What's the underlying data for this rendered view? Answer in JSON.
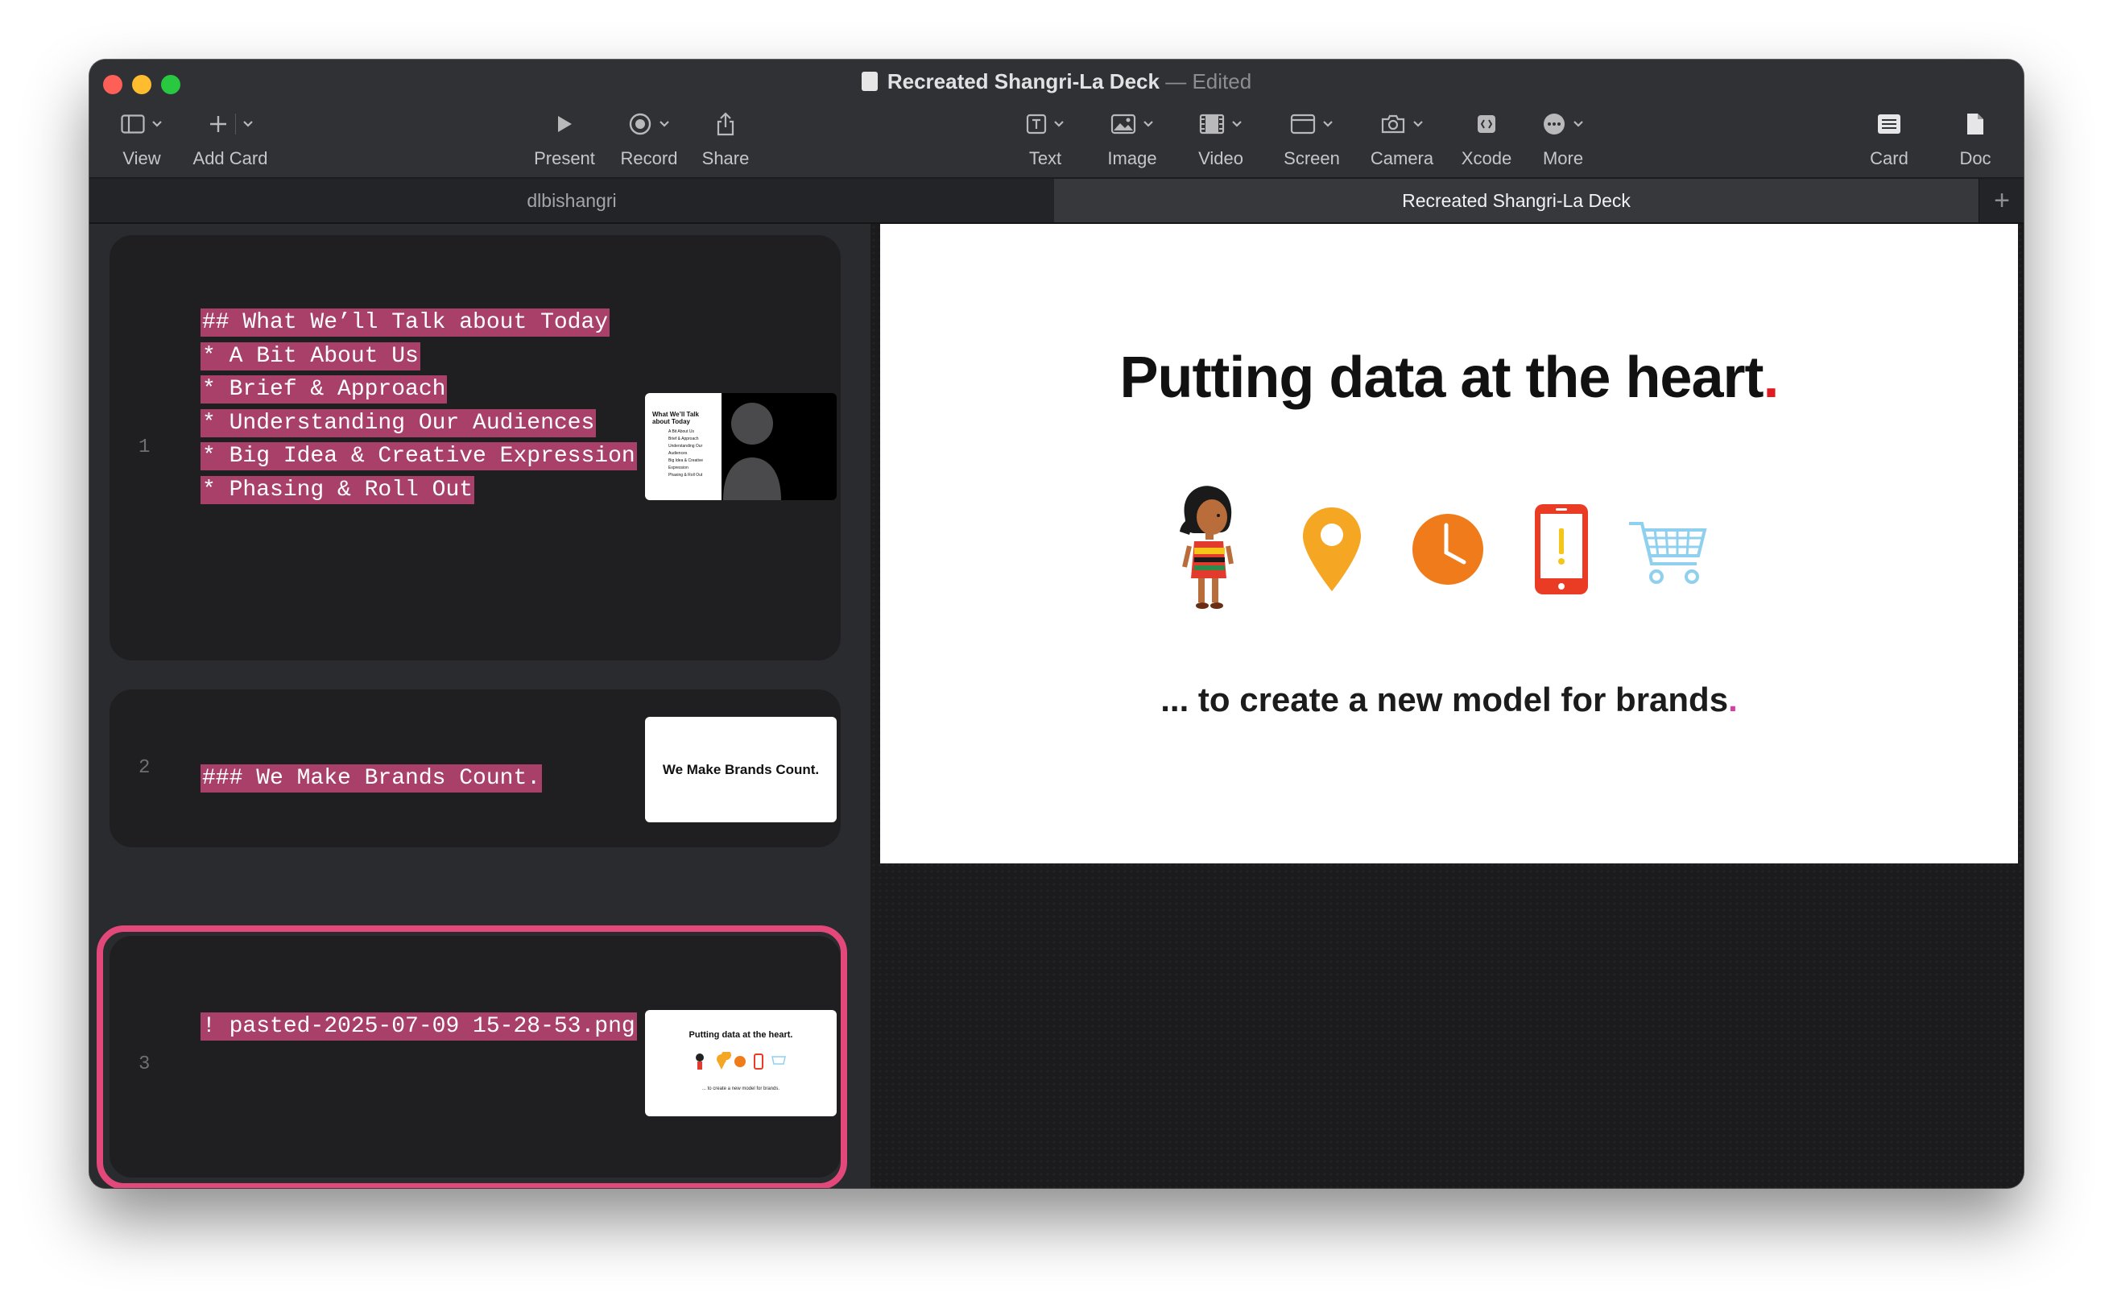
{
  "window": {
    "title": "Recreated Shangri-La Deck",
    "separator": "—",
    "status": "Edited"
  },
  "toolbar": {
    "view": "View",
    "add_card": "Add Card",
    "present": "Present",
    "record": "Record",
    "share": "Share",
    "text": "Text",
    "image": "Image",
    "video": "Video",
    "screen": "Screen",
    "camera": "Camera",
    "xcode": "Xcode",
    "more": "More",
    "card": "Card",
    "doc": "Doc"
  },
  "tabs": [
    {
      "label": "dlbishangri",
      "active": false
    },
    {
      "label": "Recreated Shangri-La Deck",
      "active": true
    }
  ],
  "cards": [
    {
      "number": "1",
      "lines": [
        "## What We’ll Talk about Today",
        "* A Bit About Us",
        "* Brief & Approach",
        "* Understanding Our Audiences",
        "* Big Idea & Creative Expression",
        "* Phasing & Roll Out"
      ],
      "thumb": {
        "title": "What We’ll Talk about Today",
        "bullets": [
          "A Bit About Us",
          "Brief & Approach",
          "Understanding Our Audiences",
          "Big Idea & Creative Expression",
          "Phasing & Roll Out"
        ]
      }
    },
    {
      "number": "2",
      "lines": [
        "### We Make Brands Count."
      ],
      "thumb": {
        "title": "We Make Brands Count."
      }
    },
    {
      "number": "3",
      "lines": [
        "! pasted-2025-07-09 15-28-53.png"
      ],
      "thumb": {
        "title": "Putting data at the heart.",
        "subtitle": "... to create a new model for brands."
      },
      "selected": true
    }
  ],
  "slide": {
    "title": "Putting data at the heart",
    "title_end": ".",
    "subtitle": "... to create a new model for brands",
    "subtitle_end": ".",
    "colors": {
      "pin": "#f5a623",
      "clock": "#f07b1a",
      "phone": "#ea3b24",
      "cart": "#8fd0ee",
      "dot_red": "#e01b24",
      "dot_pink": "#d63fa4"
    },
    "icons": [
      "girl-illustration",
      "location-pin-icon",
      "clock-icon",
      "smartphone-alert-icon",
      "shopping-cart-icon"
    ]
  },
  "accent": "#e3487b",
  "highlight": "#a84069"
}
